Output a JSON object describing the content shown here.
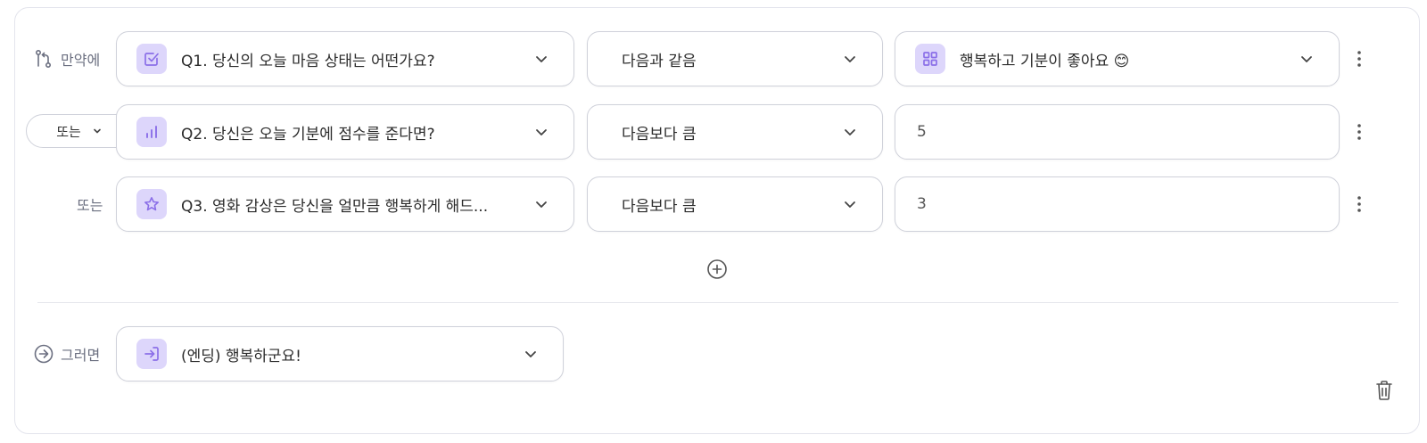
{
  "rule": {
    "if_label": "만약에",
    "or_label": "또는",
    "then_label": "그러면",
    "conditions": [
      {
        "connector": "",
        "question": "Q1. 당신의 오늘 마음 상태는 어떤가요?",
        "question_icon": "checkbox-icon",
        "operator": "다음과 같음",
        "value": "행복하고 기분이 좋아요 😊",
        "value_icon": "grid-icon",
        "value_is_choice": true
      },
      {
        "connector": "또는",
        "question": "Q2. 당신은 오늘 기분에 점수를 준다면?",
        "question_icon": "bar-chart-icon",
        "operator": "다음보다 큼",
        "value": "5",
        "value_is_choice": false
      },
      {
        "connector": "또는",
        "question": "Q3. 영화 감상은 당신을 얼만큼 행복하게 해드...",
        "question_icon": "star-icon",
        "operator": "다음보다 큼",
        "value": "3",
        "value_is_choice": false
      }
    ],
    "then_target": "(엔딩) 행복하군요!",
    "then_icon": "jump-icon"
  },
  "colors": {
    "accent": "#8b6fe8",
    "badge_bg": "#ddd6fb",
    "border": "#cfd1da",
    "label_text": "#6b6f80"
  }
}
